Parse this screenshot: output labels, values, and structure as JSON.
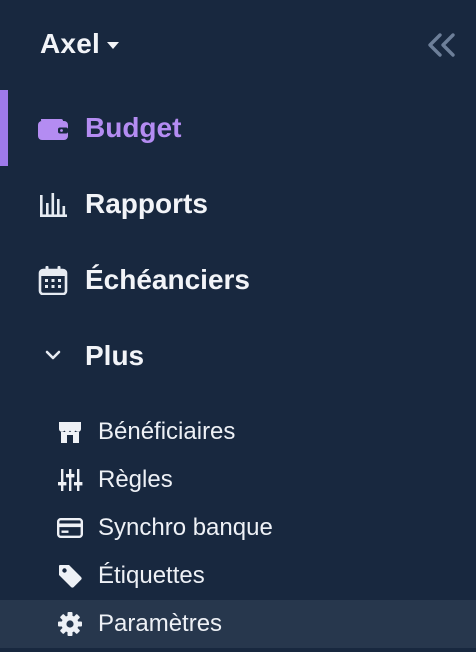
{
  "header": {
    "budget_name": "Axel",
    "collapse_icon": "double-chevron-left-icon"
  },
  "nav": [
    {
      "label": "Budget",
      "icon": "wallet-icon",
      "active": true
    },
    {
      "label": "Rapports",
      "icon": "bar-chart-icon",
      "active": false
    },
    {
      "label": "Échéanciers",
      "icon": "calendar-icon",
      "active": false
    },
    {
      "label": "Plus",
      "icon": "chevron-down-icon",
      "active": false
    }
  ],
  "more": [
    {
      "label": "Bénéficiaires",
      "icon": "store-icon"
    },
    {
      "label": "Règles",
      "icon": "sliders-icon"
    },
    {
      "label": "Synchro banque",
      "icon": "credit-card-icon"
    },
    {
      "label": "Étiquettes",
      "icon": "tag-icon"
    },
    {
      "label": "Paramètres",
      "icon": "gear-icon",
      "selected": true
    }
  ],
  "colors": {
    "background": "#18283f",
    "active_accent": "#9f7aea",
    "active_text": "#b48cf2",
    "selected_row": "#27374d"
  }
}
